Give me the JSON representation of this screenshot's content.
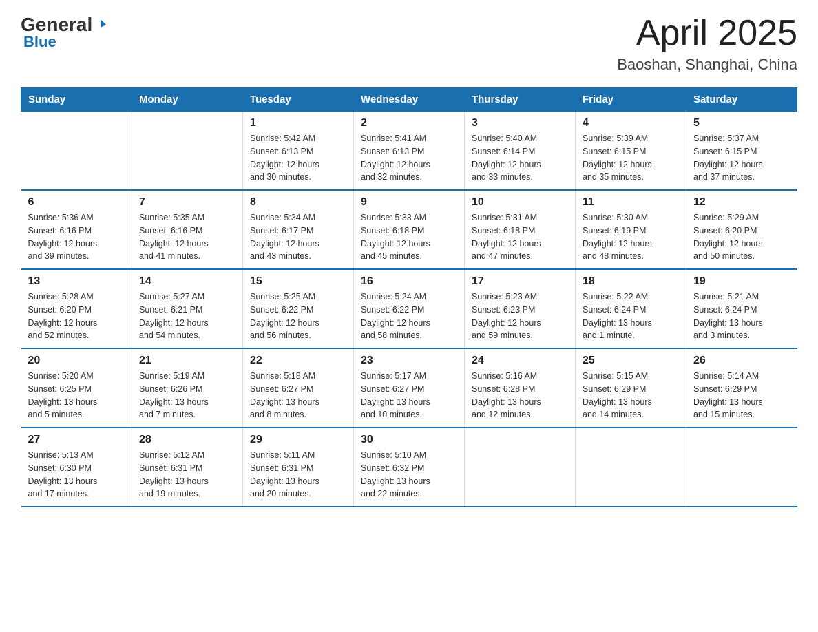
{
  "header": {
    "logo": {
      "general": "General",
      "blue": "Blue",
      "sub": "Blue"
    },
    "title": "April 2025",
    "subtitle": "Baoshan, Shanghai, China"
  },
  "calendar": {
    "days_of_week": [
      "Sunday",
      "Monday",
      "Tuesday",
      "Wednesday",
      "Thursday",
      "Friday",
      "Saturday"
    ],
    "weeks": [
      [
        {
          "day": "",
          "info": ""
        },
        {
          "day": "",
          "info": ""
        },
        {
          "day": "1",
          "info": "Sunrise: 5:42 AM\nSunset: 6:13 PM\nDaylight: 12 hours\nand 30 minutes."
        },
        {
          "day": "2",
          "info": "Sunrise: 5:41 AM\nSunset: 6:13 PM\nDaylight: 12 hours\nand 32 minutes."
        },
        {
          "day": "3",
          "info": "Sunrise: 5:40 AM\nSunset: 6:14 PM\nDaylight: 12 hours\nand 33 minutes."
        },
        {
          "day": "4",
          "info": "Sunrise: 5:39 AM\nSunset: 6:15 PM\nDaylight: 12 hours\nand 35 minutes."
        },
        {
          "day": "5",
          "info": "Sunrise: 5:37 AM\nSunset: 6:15 PM\nDaylight: 12 hours\nand 37 minutes."
        }
      ],
      [
        {
          "day": "6",
          "info": "Sunrise: 5:36 AM\nSunset: 6:16 PM\nDaylight: 12 hours\nand 39 minutes."
        },
        {
          "day": "7",
          "info": "Sunrise: 5:35 AM\nSunset: 6:16 PM\nDaylight: 12 hours\nand 41 minutes."
        },
        {
          "day": "8",
          "info": "Sunrise: 5:34 AM\nSunset: 6:17 PM\nDaylight: 12 hours\nand 43 minutes."
        },
        {
          "day": "9",
          "info": "Sunrise: 5:33 AM\nSunset: 6:18 PM\nDaylight: 12 hours\nand 45 minutes."
        },
        {
          "day": "10",
          "info": "Sunrise: 5:31 AM\nSunset: 6:18 PM\nDaylight: 12 hours\nand 47 minutes."
        },
        {
          "day": "11",
          "info": "Sunrise: 5:30 AM\nSunset: 6:19 PM\nDaylight: 12 hours\nand 48 minutes."
        },
        {
          "day": "12",
          "info": "Sunrise: 5:29 AM\nSunset: 6:20 PM\nDaylight: 12 hours\nand 50 minutes."
        }
      ],
      [
        {
          "day": "13",
          "info": "Sunrise: 5:28 AM\nSunset: 6:20 PM\nDaylight: 12 hours\nand 52 minutes."
        },
        {
          "day": "14",
          "info": "Sunrise: 5:27 AM\nSunset: 6:21 PM\nDaylight: 12 hours\nand 54 minutes."
        },
        {
          "day": "15",
          "info": "Sunrise: 5:25 AM\nSunset: 6:22 PM\nDaylight: 12 hours\nand 56 minutes."
        },
        {
          "day": "16",
          "info": "Sunrise: 5:24 AM\nSunset: 6:22 PM\nDaylight: 12 hours\nand 58 minutes."
        },
        {
          "day": "17",
          "info": "Sunrise: 5:23 AM\nSunset: 6:23 PM\nDaylight: 12 hours\nand 59 minutes."
        },
        {
          "day": "18",
          "info": "Sunrise: 5:22 AM\nSunset: 6:24 PM\nDaylight: 13 hours\nand 1 minute."
        },
        {
          "day": "19",
          "info": "Sunrise: 5:21 AM\nSunset: 6:24 PM\nDaylight: 13 hours\nand 3 minutes."
        }
      ],
      [
        {
          "day": "20",
          "info": "Sunrise: 5:20 AM\nSunset: 6:25 PM\nDaylight: 13 hours\nand 5 minutes."
        },
        {
          "day": "21",
          "info": "Sunrise: 5:19 AM\nSunset: 6:26 PM\nDaylight: 13 hours\nand 7 minutes."
        },
        {
          "day": "22",
          "info": "Sunrise: 5:18 AM\nSunset: 6:27 PM\nDaylight: 13 hours\nand 8 minutes."
        },
        {
          "day": "23",
          "info": "Sunrise: 5:17 AM\nSunset: 6:27 PM\nDaylight: 13 hours\nand 10 minutes."
        },
        {
          "day": "24",
          "info": "Sunrise: 5:16 AM\nSunset: 6:28 PM\nDaylight: 13 hours\nand 12 minutes."
        },
        {
          "day": "25",
          "info": "Sunrise: 5:15 AM\nSunset: 6:29 PM\nDaylight: 13 hours\nand 14 minutes."
        },
        {
          "day": "26",
          "info": "Sunrise: 5:14 AM\nSunset: 6:29 PM\nDaylight: 13 hours\nand 15 minutes."
        }
      ],
      [
        {
          "day": "27",
          "info": "Sunrise: 5:13 AM\nSunset: 6:30 PM\nDaylight: 13 hours\nand 17 minutes."
        },
        {
          "day": "28",
          "info": "Sunrise: 5:12 AM\nSunset: 6:31 PM\nDaylight: 13 hours\nand 19 minutes."
        },
        {
          "day": "29",
          "info": "Sunrise: 5:11 AM\nSunset: 6:31 PM\nDaylight: 13 hours\nand 20 minutes."
        },
        {
          "day": "30",
          "info": "Sunrise: 5:10 AM\nSunset: 6:32 PM\nDaylight: 13 hours\nand 22 minutes."
        },
        {
          "day": "",
          "info": ""
        },
        {
          "day": "",
          "info": ""
        },
        {
          "day": "",
          "info": ""
        }
      ]
    ]
  }
}
